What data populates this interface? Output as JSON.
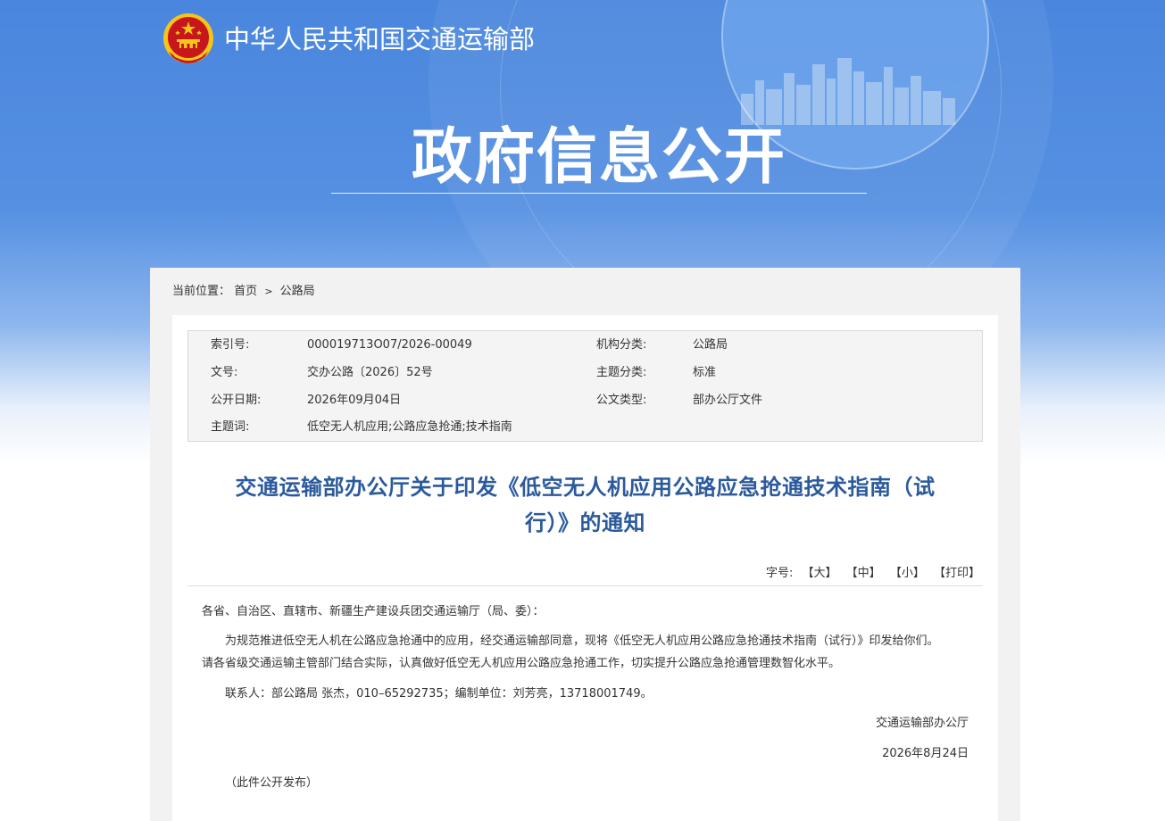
{
  "header": {
    "site_name": "中华人民共和国交通运输部",
    "section_title": "政府信息公开"
  },
  "breadcrumb": {
    "label": "当前位置：",
    "items": [
      "首页",
      "公路局"
    ],
    "separator": ">"
  },
  "meta": {
    "index_label": "索引号:",
    "index_value": "000019713O07/2026-00049",
    "org_label": "机构分类:",
    "org_value": "公路局",
    "docno_label": "文号:",
    "docno_value": "交办公路〔2026〕52号",
    "topic_label": "主题分类:",
    "topic_value": "标准",
    "date_label": "公开日期:",
    "date_value": "2026年09月04日",
    "type_label": "公文类型:",
    "type_value": "部办公厅文件",
    "keywords_label": "主题词:",
    "keywords_value": "低空无人机应用;公路应急抢通;技术指南"
  },
  "document": {
    "title_line1": "交通运输部办公厅关于印发《低空无人机应用公路应急抢通技术指南（试",
    "title_line2": "行）》的通知",
    "font_label": "字号:",
    "font_large": "【大】",
    "font_medium": "【中】",
    "font_small": "【小】",
    "print": "【打印】",
    "salutation": "各省、自治区、直辖市、新疆生产建设兵团交通运输厅（局、委）：",
    "para1_line1": "为规范推进低空无人机在公路应急抢通中的应用，经交通运输部同意，现将《低空无人机应用公路应急抢通技术指南（试行）》印发给你们。",
    "para1_line2": "请各省级交通运输主管部门结合实际，认真做好低空无人机应用公路应急抢通工作，切实提升公路应急抢通管理数智化水平。",
    "contact": "联系人：部公路局 张杰，010–65292735；编制单位：刘芳亮，13718001749。",
    "signature": "交通运输部办公厅",
    "sign_date": "2026年8月24日",
    "note": "（此件公开发布）"
  },
  "colors": {
    "banner_blue": "#4a86dd",
    "title_blue": "#2b5a9c",
    "emblem_red": "#c8161d",
    "emblem_gold": "#f5c518"
  },
  "icons": {
    "emblem": "national-emblem-icon"
  }
}
